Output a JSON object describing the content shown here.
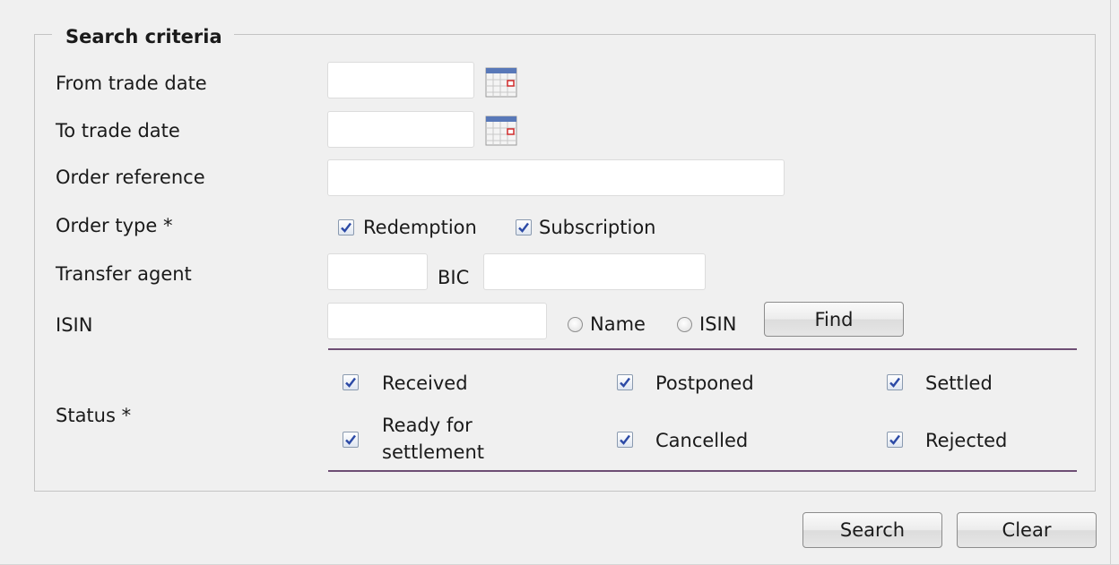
{
  "form": {
    "legend": "Search criteria",
    "from_trade_date": {
      "label": "From trade date",
      "value": ""
    },
    "to_trade_date": {
      "label": "To trade date",
      "value": ""
    },
    "order_reference": {
      "label": "Order reference",
      "value": ""
    },
    "order_type": {
      "label": "Order type *",
      "options": [
        {
          "label": "Redemption",
          "checked": true
        },
        {
          "label": "Subscription",
          "checked": true
        }
      ]
    },
    "transfer_agent": {
      "label": "Transfer agent",
      "value": "",
      "bic_label": "BIC",
      "bic_value": ""
    },
    "isin": {
      "label": "ISIN",
      "value": "",
      "radio_name": "Name",
      "radio_isin": "ISIN",
      "find_label": "Find"
    },
    "status": {
      "label": "Status *",
      "options": [
        {
          "label": "Received",
          "checked": true
        },
        {
          "label": "Postponed",
          "checked": true
        },
        {
          "label": "Settled",
          "checked": true
        },
        {
          "label": "Ready for\nsettlement",
          "checked": true
        },
        {
          "label": "Cancelled",
          "checked": true
        },
        {
          "label": "Rejected",
          "checked": true
        }
      ]
    }
  },
  "actions": {
    "search_label": "Search",
    "clear_label": "Clear"
  },
  "icons": {
    "calendar": "calendar-icon",
    "checkmark": "checkmark-icon"
  },
  "colors": {
    "separator": "#6e4e74",
    "checkmark": "#2c4aa6",
    "calendar_header": "#5878b8",
    "calendar_marker": "#d02a2a"
  }
}
